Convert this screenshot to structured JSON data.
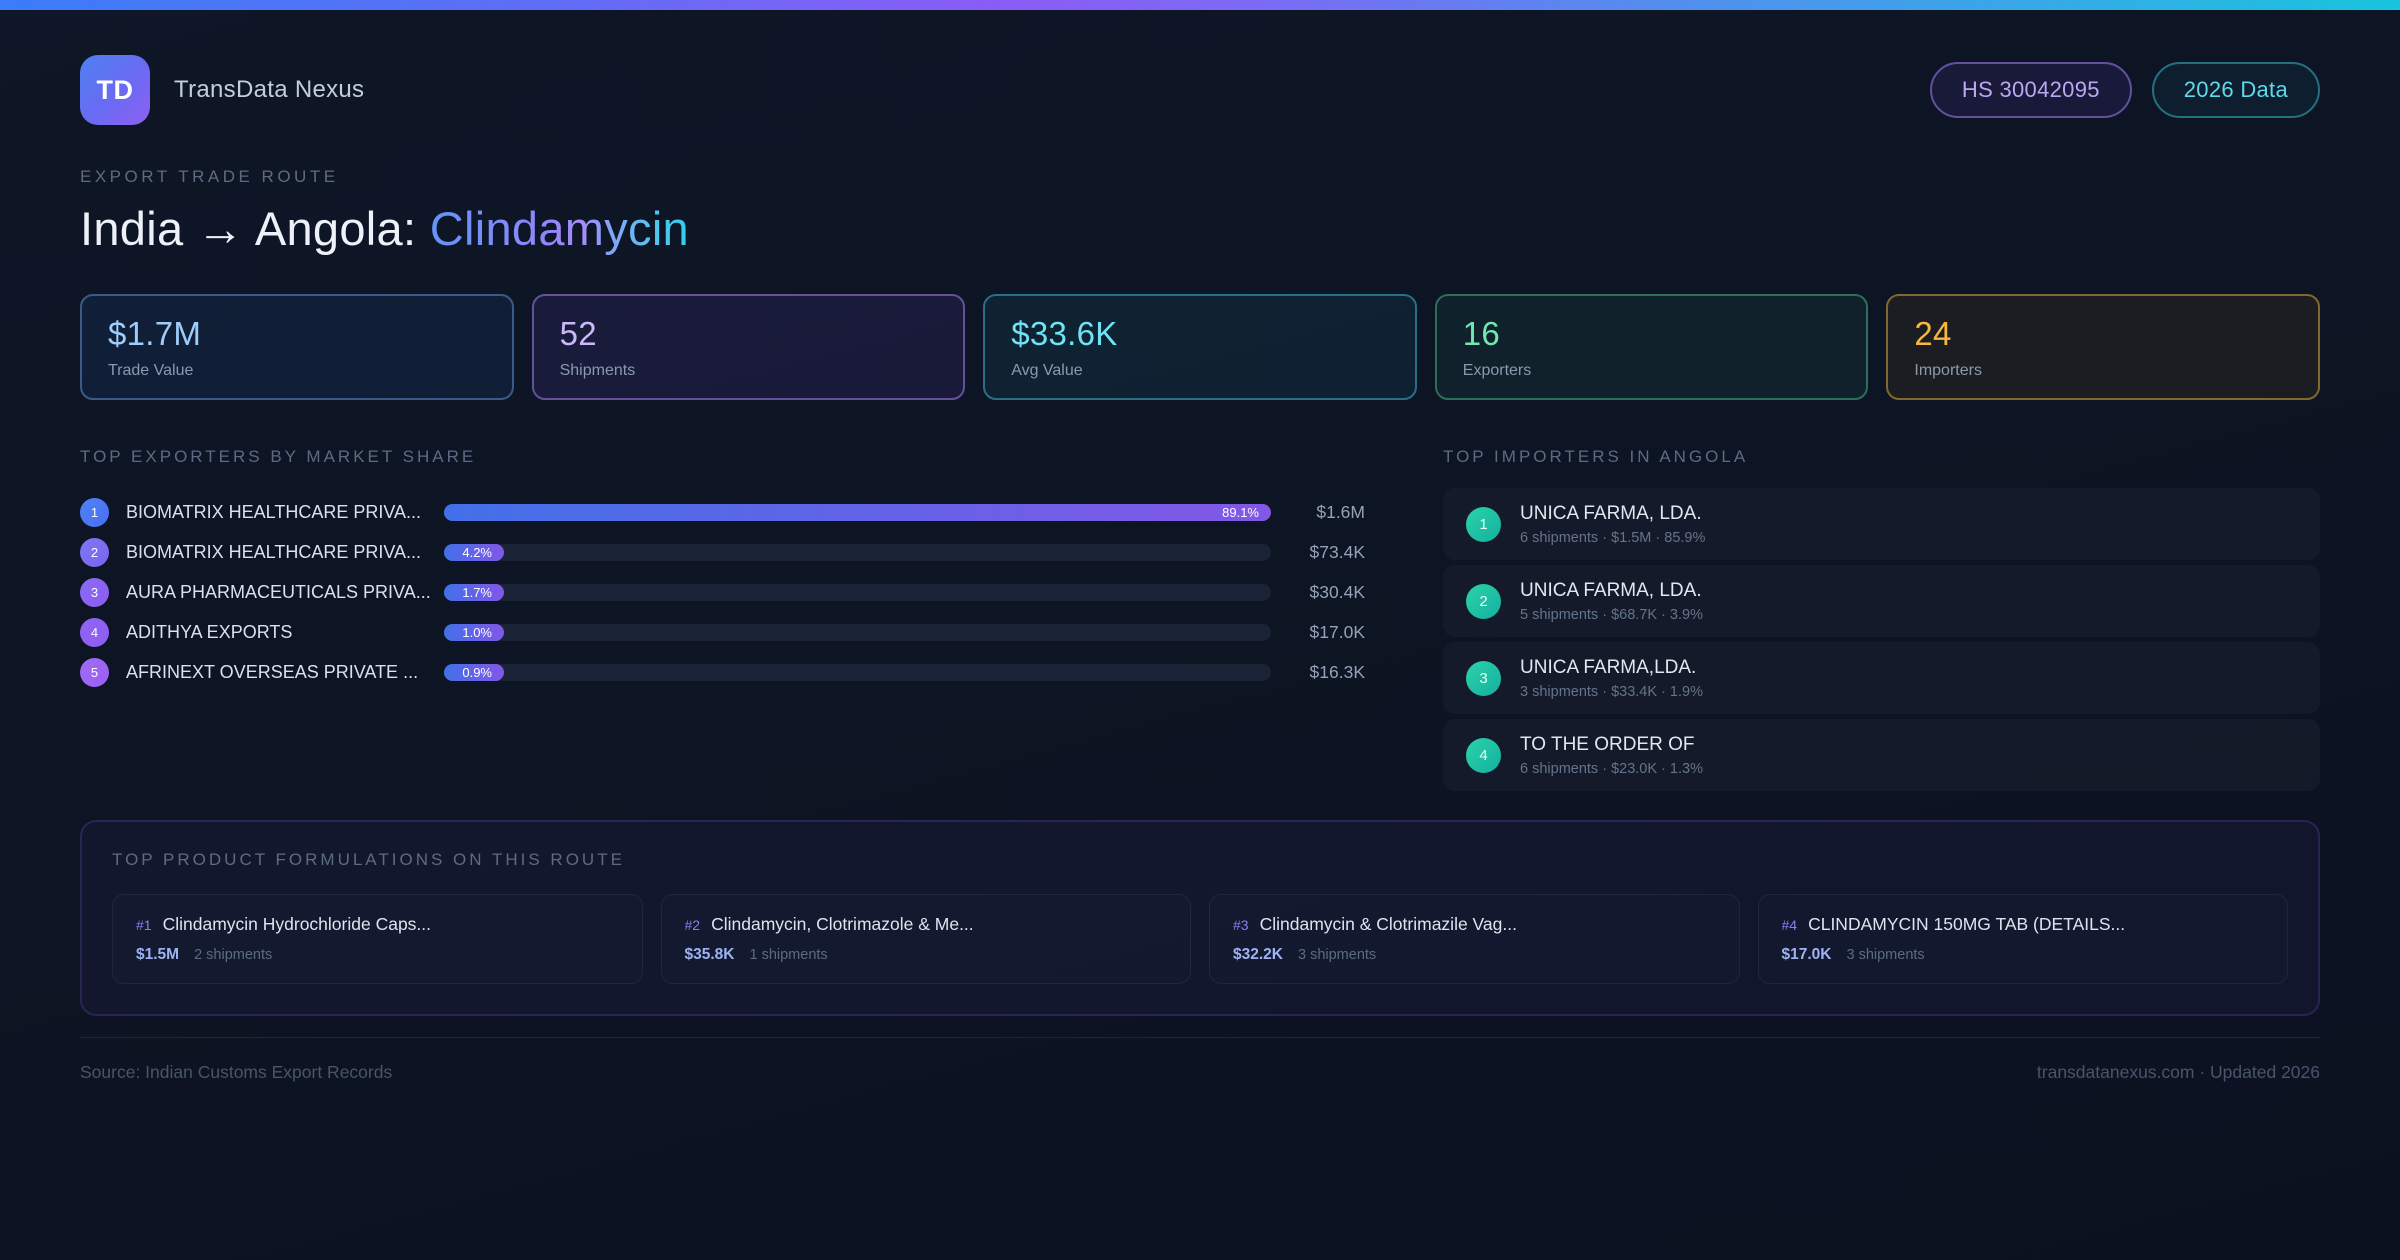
{
  "header": {
    "logo_text": "TD",
    "app_name": "TransData Nexus",
    "hs_badge": "HS 30042095",
    "year_badge": "2026 Data"
  },
  "hero": {
    "eyebrow": "EXPORT TRADE ROUTE",
    "title_plain": "India → Angola: ",
    "title_accent": "Clindamycin"
  },
  "stats": [
    {
      "value": "$1.7M",
      "label": "Trade Value"
    },
    {
      "value": "52",
      "label": "Shipments"
    },
    {
      "value": "$33.6K",
      "label": "Avg Value"
    },
    {
      "value": "16",
      "label": "Exporters"
    },
    {
      "value": "24",
      "label": "Importers"
    }
  ],
  "exporters": {
    "heading": "TOP EXPORTERS BY MARKET SHARE",
    "rows": [
      {
        "rank": "1",
        "name": "BIOMATRIX HEALTHCARE PRIVA...",
        "share_label": "89.1%",
        "value": "$1.6M",
        "bar_width": "100%"
      },
      {
        "rank": "2",
        "name": "BIOMATRIX HEALTHCARE PRIVA...",
        "share_label": "4.2%",
        "value": "$73.4K",
        "bar_width": "4.7%"
      },
      {
        "rank": "3",
        "name": "AURA PHARMACEUTICALS PRIVA...",
        "share_label": "1.7%",
        "value": "$30.4K",
        "bar_width": "1.9%"
      },
      {
        "rank": "4",
        "name": "ADITHYA EXPORTS",
        "share_label": "1.0%",
        "value": "$17.0K",
        "bar_width": "1.1%"
      },
      {
        "rank": "5",
        "name": "AFRINEXT OVERSEAS PRIVATE ...",
        "share_label": "0.9%",
        "value": "$16.3K",
        "bar_width": "1.0%"
      }
    ]
  },
  "importers": {
    "heading": "TOP IMPORTERS IN ANGOLA",
    "rows": [
      {
        "rank": "1",
        "name": "UNICA FARMA, LDA.",
        "meta": "6 shipments · $1.5M · 85.9%"
      },
      {
        "rank": "2",
        "name": "UNICA FARMA, LDA.",
        "meta": "5 shipments · $68.7K · 3.9%"
      },
      {
        "rank": "3",
        "name": "UNICA FARMA,LDA.",
        "meta": "3 shipments · $33.4K · 1.9%"
      },
      {
        "rank": "4",
        "name": "TO THE ORDER OF",
        "meta": "6 shipments · $23.0K · 1.3%"
      }
    ]
  },
  "formulations": {
    "heading": "TOP PRODUCT FORMULATIONS ON THIS ROUTE",
    "cards": [
      {
        "rank": "#1",
        "name": "Clindamycin Hydrochloride Caps...",
        "value": "$1.5M",
        "shipments": "2 shipments"
      },
      {
        "rank": "#2",
        "name": "Clindamycin, Clotrimazole & Me...",
        "value": "$35.8K",
        "shipments": "1 shipments"
      },
      {
        "rank": "#3",
        "name": "Clindamycin & Clotrimazile Vag...",
        "value": "$32.2K",
        "shipments": "3 shipments"
      },
      {
        "rank": "#4",
        "name": "CLINDAMYCIN 150MG TAB (DETAILS...",
        "value": "$17.0K",
        "shipments": "3 shipments"
      }
    ]
  },
  "footer": {
    "source": "Source: Indian Customs Export Records",
    "site": "transdatanexus.com · Updated 2026"
  },
  "colors": {
    "topbar_gradient": [
      "#3b7df8",
      "#8b5cf6",
      "#19c4dd"
    ],
    "bar_gradient": [
      "#4270e8",
      "#8257e6"
    ],
    "stat_accents": [
      "#9ecdfb",
      "#cbb8fa",
      "#6fe3f5",
      "#72e7b6",
      "#f5b83d"
    ],
    "importer_badge": "#1fc3a4",
    "hs_badge_text": "#b9a8f2",
    "year_badge_text": "#5fd9ec"
  },
  "chart_data": {
    "type": "bar",
    "title": "TOP EXPORTERS BY MARKET SHARE",
    "categories": [
      "BIOMATRIX HEALTHCARE PRIVA...",
      "BIOMATRIX HEALTHCARE PRIVA...",
      "AURA PHARMACEUTICALS PRIVA...",
      "ADITHYA EXPORTS",
      "AFRINEXT OVERSEAS PRIVATE ..."
    ],
    "values": [
      89.1,
      4.2,
      1.7,
      1.0,
      0.9
    ],
    "value_labels": [
      "$1.6M",
      "$73.4K",
      "$30.4K",
      "$17.0K",
      "$16.3K"
    ],
    "xlabel": "",
    "ylabel": "Market share (%)",
    "xlim": [
      0,
      100
    ],
    "orientation": "horizontal",
    "grid": false,
    "legend": false
  }
}
